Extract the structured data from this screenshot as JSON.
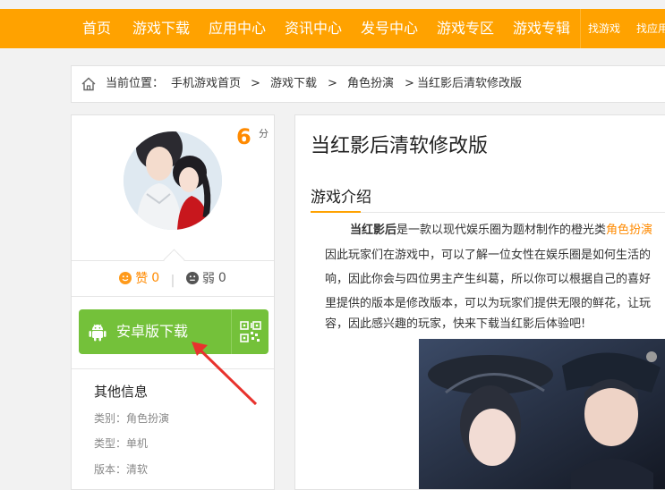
{
  "nav": {
    "items": [
      "首页",
      "游戏下载",
      "应用中心",
      "资讯中心",
      "发号中心",
      "游戏专区",
      "游戏专辑"
    ],
    "small_items": [
      "找游戏",
      "找应用"
    ]
  },
  "breadcrumb": {
    "prefix": "当前位置：",
    "items": [
      "手机游戏首页",
      "游戏下载",
      "角色扮演",
      "当红影后清软修改版"
    ],
    "separator": ">"
  },
  "sidebar": {
    "score": "6",
    "score_unit": "分",
    "like_label": "赞",
    "like_count": "0",
    "dislike_label": "弱",
    "dislike_count": "0",
    "download_label": "安卓版下载",
    "info_title": "其他信息",
    "info": [
      {
        "label": "类别：",
        "value": "角色扮演"
      },
      {
        "label": "类型：",
        "value": "单机"
      },
      {
        "label": "版本：",
        "value": "清软"
      }
    ]
  },
  "main": {
    "title": "当红影后清软修改版",
    "section_title": "游戏介绍",
    "desc_lines": [
      {
        "bold": "当红影后",
        "text": "是一款以现代娱乐圈为题材制作的橙光类",
        "highlight": "角色扮演"
      },
      {
        "text": "因此玩家们在游戏中，可以了解一位女性在娱乐圈是如何生活的"
      },
      {
        "text": "响，因此你会与四位男主产生纠葛，所以你可以根据自己的喜好"
      },
      {
        "text": "里提供的版本是修改版本，可以为玩家们提供无限的鲜花，让玩"
      },
      {
        "text": "容，因此感兴趣的玩家，快来下载当红影后体验吧!"
      }
    ]
  },
  "colors": {
    "nav_bg": "#ffa200",
    "download_bg": "#74c13a",
    "score": "#ff8a00",
    "arrow": "#e8322d"
  }
}
